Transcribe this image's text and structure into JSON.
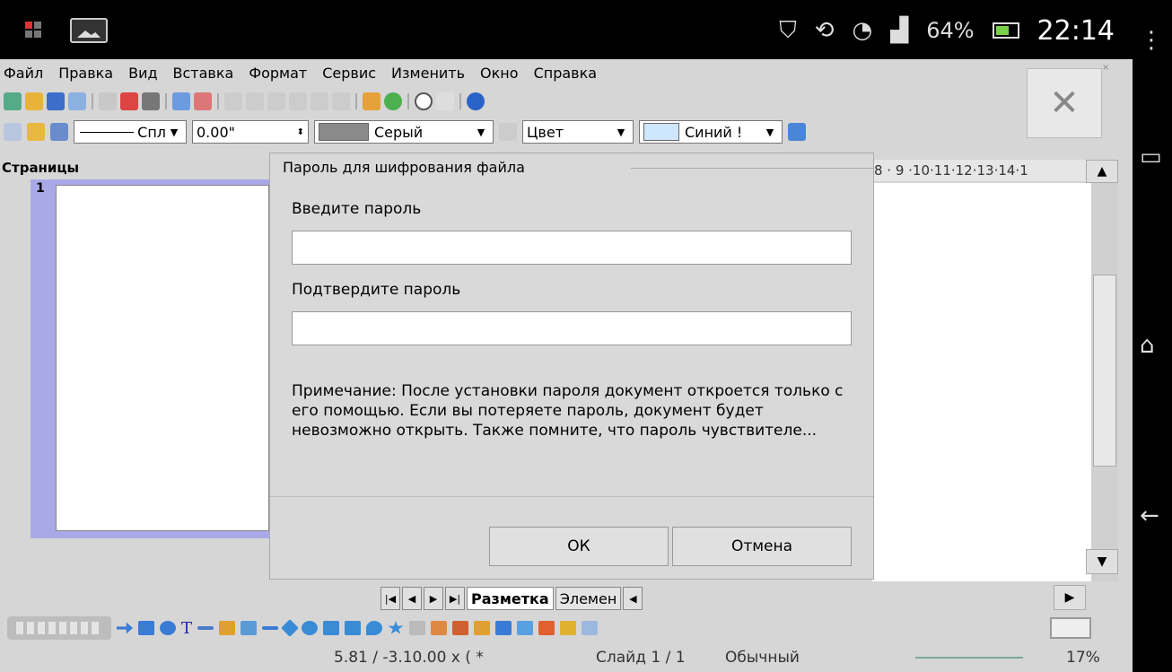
{
  "statusbar": {
    "battery_percent": "64%",
    "time": "22:14"
  },
  "menu": {
    "items": [
      "Файл",
      "Правка",
      "Вид",
      "Вставка",
      "Формат",
      "Сервис",
      "Изменить",
      "Окно",
      "Справка"
    ]
  },
  "toolbar": {
    "line_style": "Спл",
    "line_width": "0.00\"",
    "line_color": "Серый",
    "fill_type": "Цвет",
    "fill_color": "Синий !"
  },
  "pages_panel": {
    "title": "Страницы",
    "page_number": "1"
  },
  "ruler": {
    "ticks": "8 · 9 ·10·11·12·13·14·1"
  },
  "dialog": {
    "title": "Пароль для шифрования файла",
    "enter_label": "Введите пароль",
    "confirm_label": "Подтвердите пароль",
    "note": "Примечание: После установки пароля документ откроется только с его помощью. Если вы потеряете пароль, документ будет невозможно открыть. Также помните, что пароль чувствителе...",
    "ok_label": "ОК",
    "cancel_label": "Отмена"
  },
  "tabs": {
    "items": [
      "Разметка",
      "Элемен"
    ]
  },
  "status": {
    "position": "5.81 / -3.10.00 x ( *",
    "slide": "Слайд 1 / 1",
    "mode": "Обычный",
    "zoom": "17%"
  },
  "colors": {
    "line_gray": "#8a8a8a",
    "fill_blue": "#cfe6ff",
    "page_panel": "#a9a9e8"
  }
}
